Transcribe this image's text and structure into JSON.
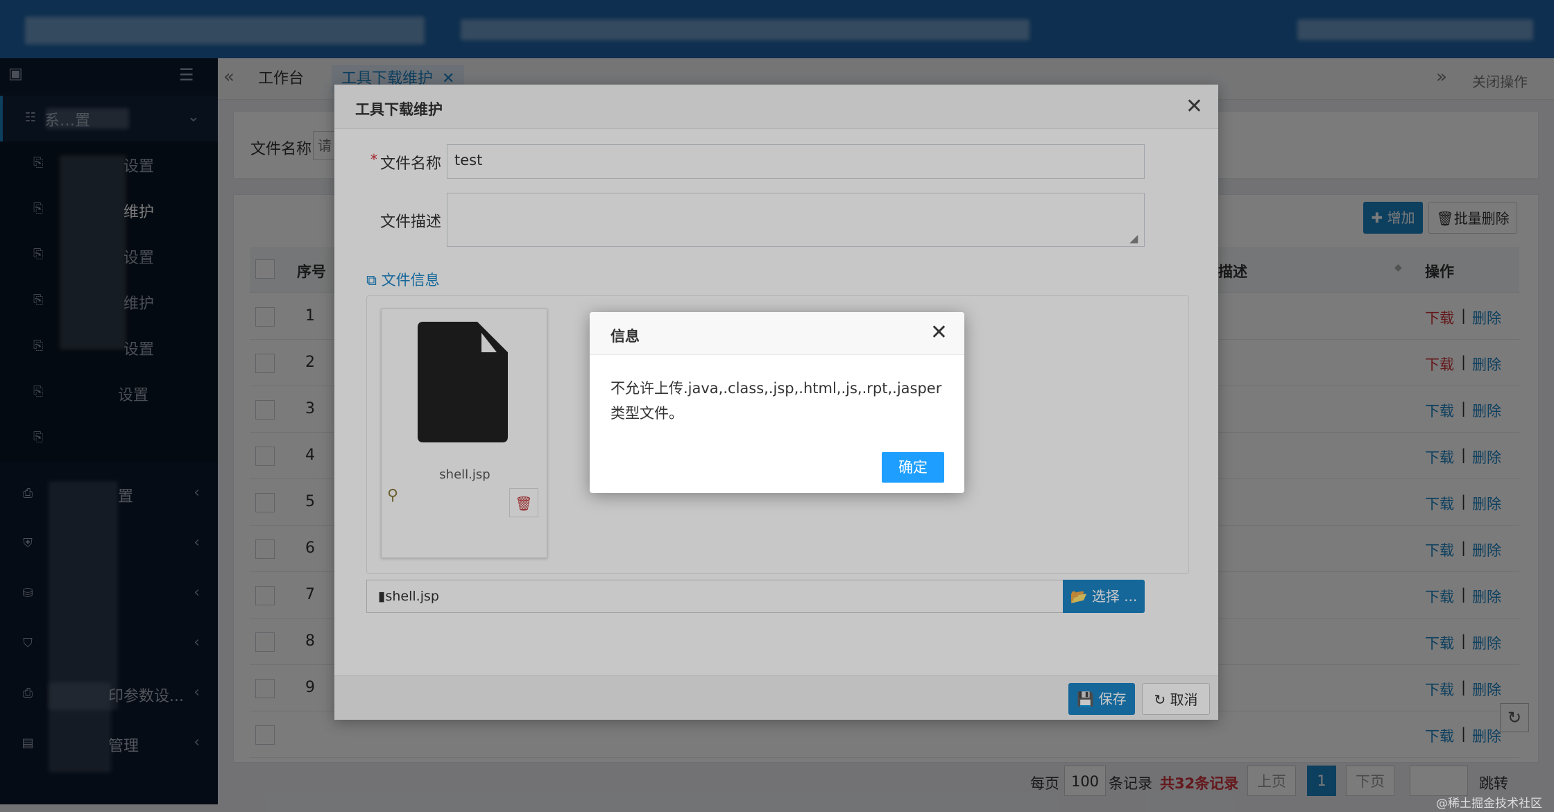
{
  "tabs": {
    "home": "工作台",
    "active": "工具下载维护",
    "close_ops": "关闭操作"
  },
  "sidebar": {
    "items": [
      {
        "label": "系…置",
        "icon": "sliders-icon"
      },
      {
        "label": "设置",
        "icon": "doc-icon"
      },
      {
        "label": "维护",
        "icon": "doc-icon"
      },
      {
        "label": "设置",
        "icon": "doc-icon"
      },
      {
        "label": "维护",
        "icon": "doc-icon"
      },
      {
        "label": "设置",
        "icon": "doc-icon"
      },
      {
        "label": "设置",
        "icon": "doc-icon"
      },
      {
        "label": "",
        "icon": "doc-icon"
      },
      {
        "label": "置",
        "icon": "printer-icon"
      },
      {
        "label": "",
        "icon": "shield-icon"
      },
      {
        "label": "",
        "icon": "database-icon"
      },
      {
        "label": "",
        "icon": "shield-check-icon"
      },
      {
        "label": "印参数设...",
        "icon": "print-icon"
      },
      {
        "label": "管理",
        "icon": "file-icon"
      }
    ]
  },
  "search": {
    "label": "文件名称",
    "placeholder": "请"
  },
  "toolbar": {
    "add": "增加",
    "batch_delete": "批量删除"
  },
  "table": {
    "headers": {
      "index": "序号",
      "desc": "描述",
      "ops": "操作"
    },
    "rows": [
      "1",
      "2",
      "3",
      "4",
      "5",
      "6",
      "7",
      "8",
      "9",
      ""
    ],
    "download": "下载",
    "delete": "删除",
    "separator": "|"
  },
  "pager": {
    "per_page": "每页",
    "size": "100",
    "records": "条记录",
    "total": "共32条记录",
    "prev": "上页",
    "page": "1",
    "next": "下页",
    "jump": "跳转"
  },
  "modal": {
    "title": "工具下载维护",
    "name_label": "文件名称",
    "name_value": "test",
    "desc_label": "文件描述",
    "section": "文件信息",
    "file_name": "shell.jsp",
    "file_path": "shell.jsp",
    "choose": "选择 ...",
    "save": "保存",
    "cancel": "取消"
  },
  "dialog": {
    "title": "信息",
    "message": "不允许上传.java,.class,.jsp,.html,.js,.rpt,.jasper类型文件。",
    "ok": "确定"
  },
  "watermark": "@稀土掘金技术社区",
  "colors": {
    "primary": "#1c84c6",
    "danger": "#d0343a",
    "dialog_ok": "#1e9fff",
    "sidebar": "#0e1a2d",
    "header": "#1f63a6"
  }
}
